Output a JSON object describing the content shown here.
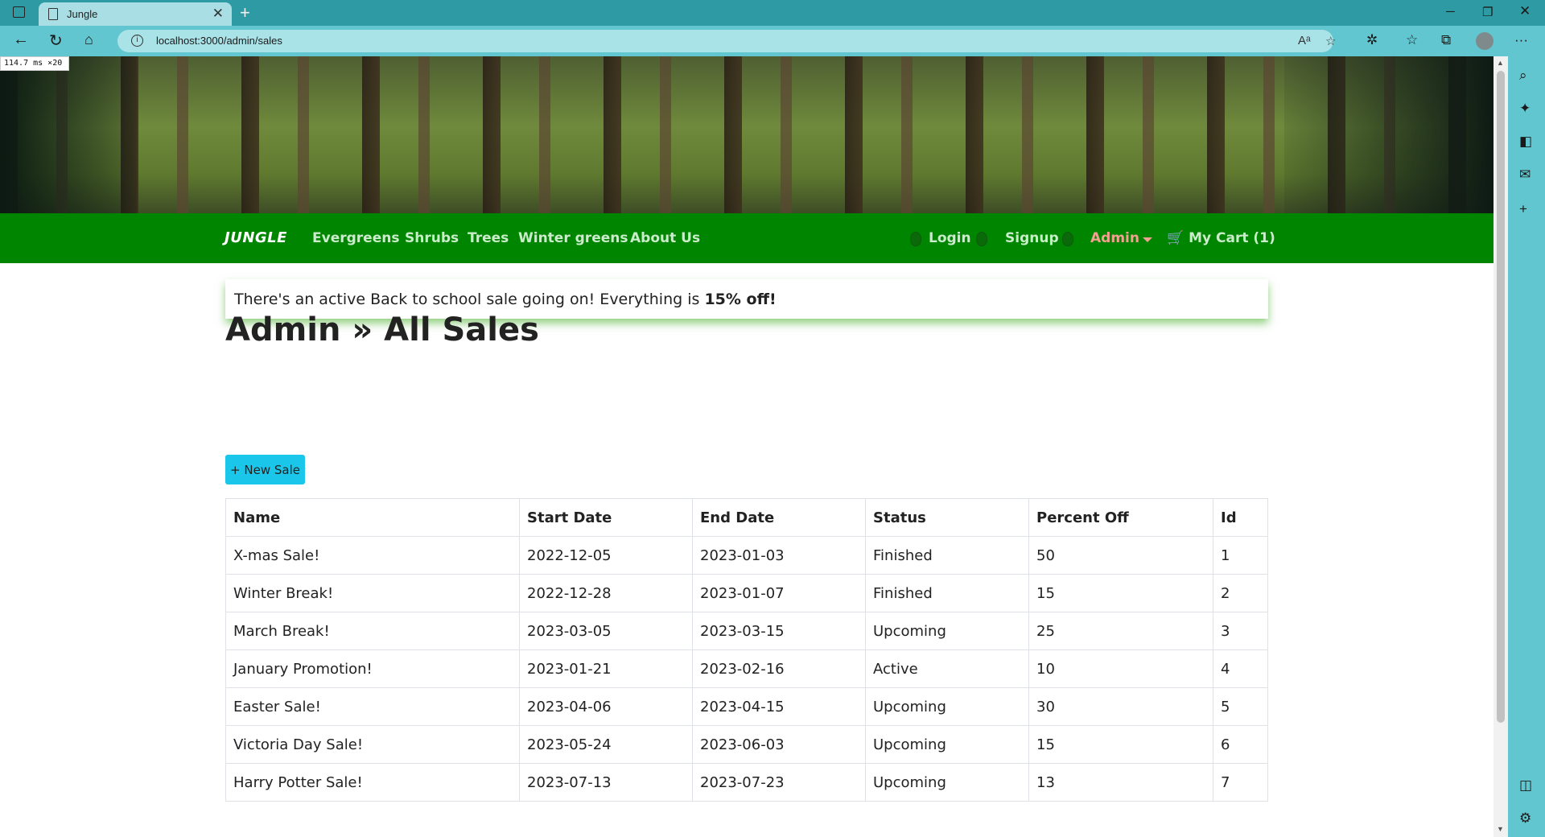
{
  "browser": {
    "tab_title": "Jungle",
    "url": "localhost:3000/admin/sales",
    "perf_readout": "114.7 ms ×20"
  },
  "navbar": {
    "brand": "JUNGLE",
    "links": [
      "Evergreens",
      "Shrubs",
      "Trees",
      "Winter greens",
      "About Us"
    ],
    "login": "Login",
    "signup": "Signup",
    "admin": "Admin",
    "cart": "My Cart (1)"
  },
  "alert": {
    "text": "There's an active Back to school sale going on! Everything is",
    "bold": "15% off!"
  },
  "page_title": "Admin » All Sales",
  "new_sale_button": "+ New Sale",
  "table": {
    "headers": [
      "Name",
      "Start Date",
      "End Date",
      "Status",
      "Percent Off",
      "Id"
    ],
    "rows": [
      [
        "X-mas Sale!",
        "2022-12-05",
        "2023-01-03",
        "Finished",
        "50",
        "1"
      ],
      [
        "Winter Break!",
        "2022-12-28",
        "2023-01-07",
        "Finished",
        "15",
        "2"
      ],
      [
        "March Break!",
        "2023-03-05",
        "2023-03-15",
        "Upcoming",
        "25",
        "3"
      ],
      [
        "January Promotion!",
        "2023-01-21",
        "2023-02-16",
        "Active",
        "10",
        "4"
      ],
      [
        "Easter Sale!",
        "2023-04-06",
        "2023-04-15",
        "Upcoming",
        "30",
        "5"
      ],
      [
        "Victoria Day Sale!",
        "2023-05-24",
        "2023-06-03",
        "Upcoming",
        "15",
        "6"
      ],
      [
        "Harry Potter Sale!",
        "2023-07-13",
        "2023-07-23",
        "Upcoming",
        "13",
        "7"
      ]
    ]
  },
  "colors": {
    "navbar_bg": "#008500",
    "admin_link": "#f4a090",
    "button_bg": "#1ac7ea",
    "browser_frame": "#2e9aa3"
  }
}
